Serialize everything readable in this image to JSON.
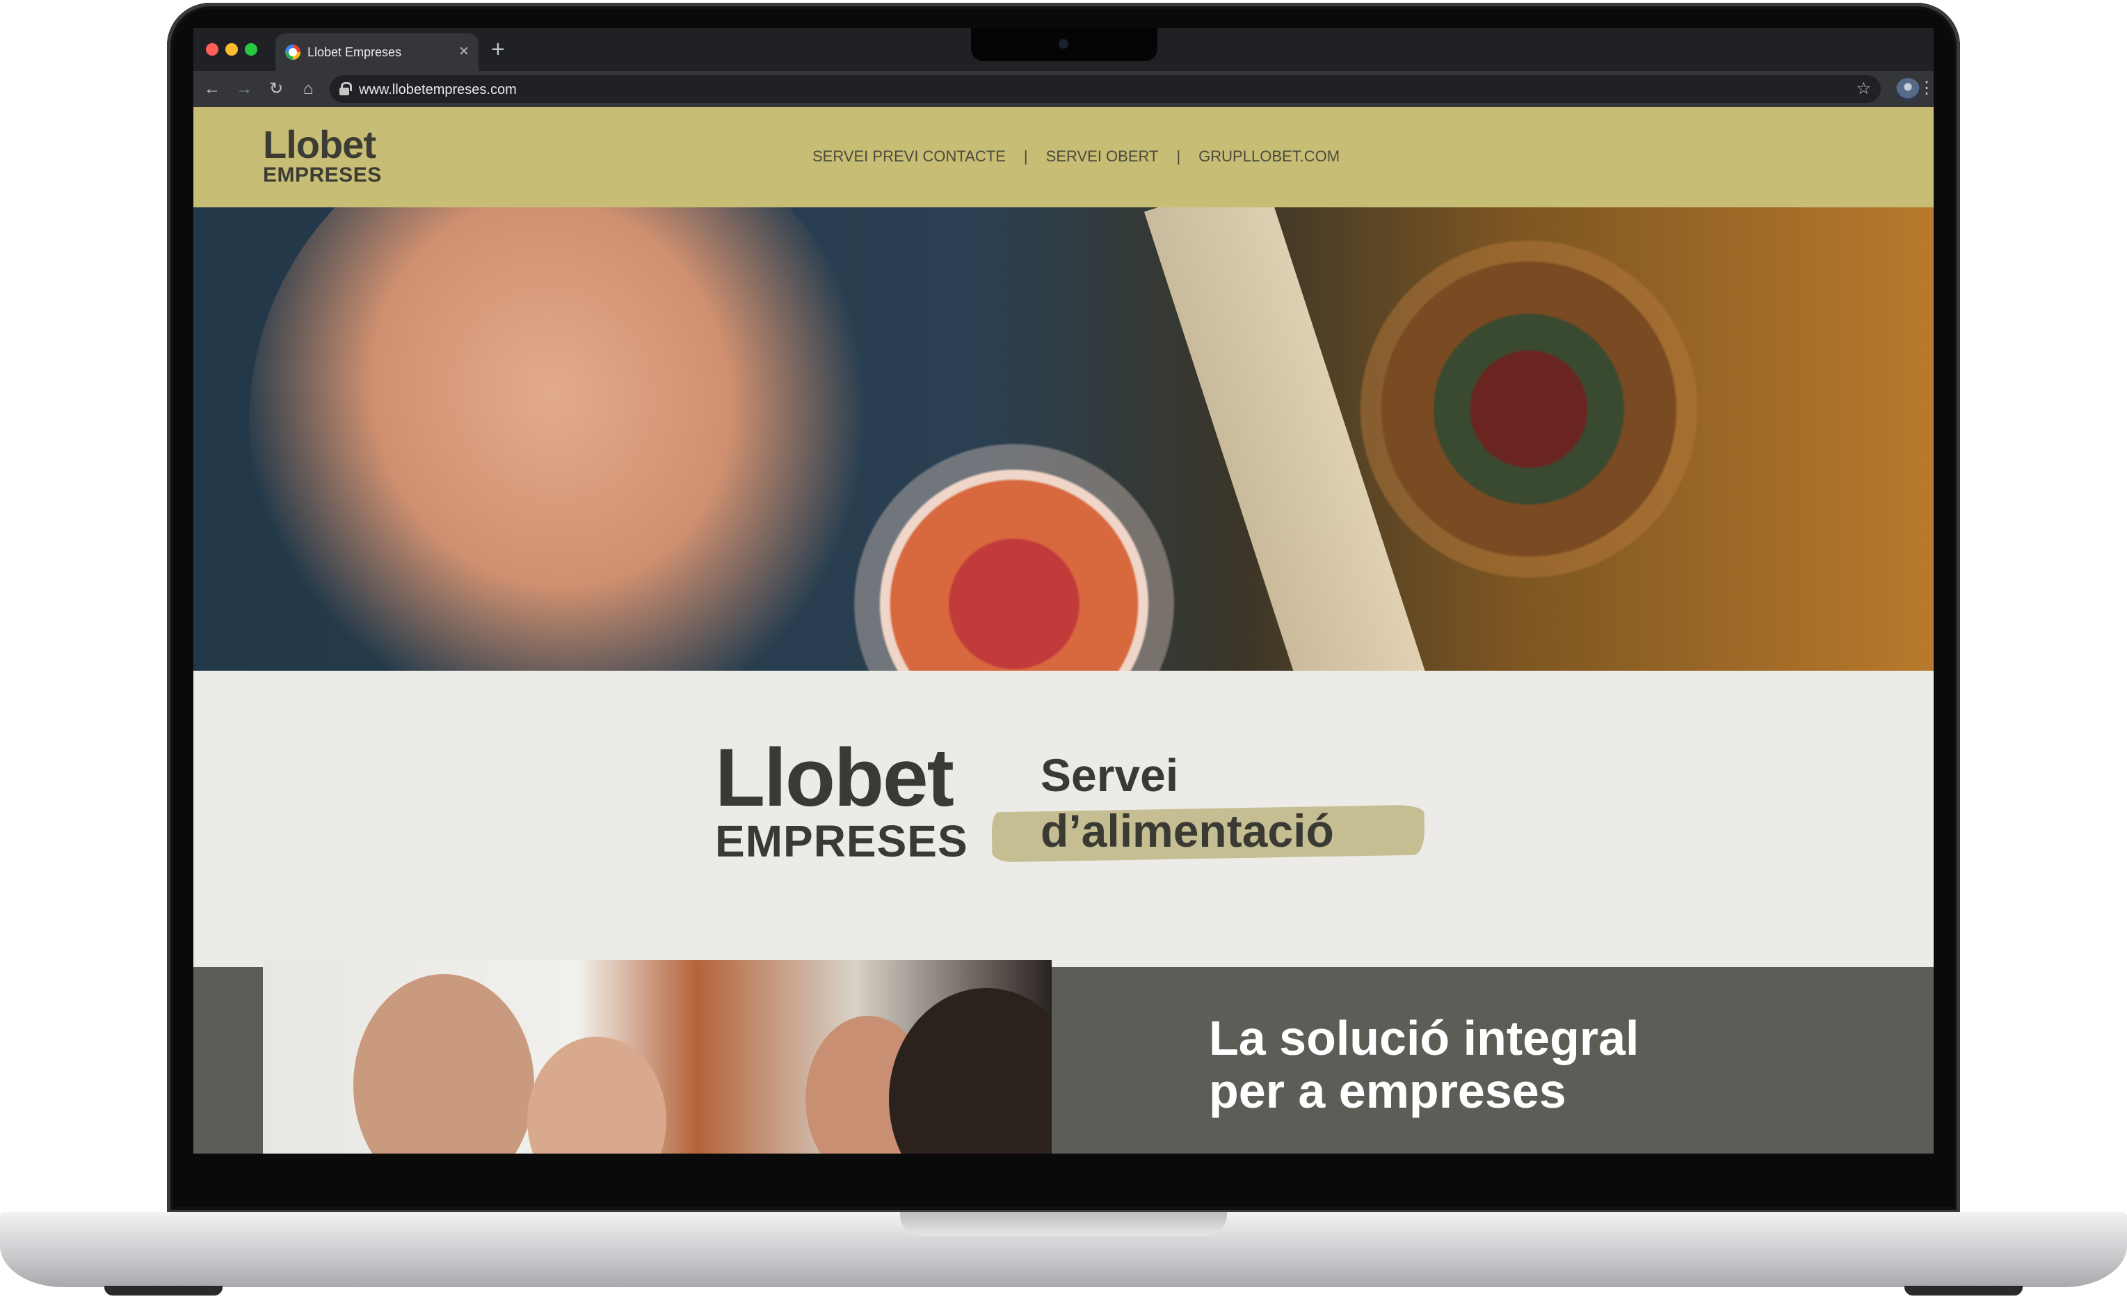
{
  "browser": {
    "tab_title": "Llobet Empreses",
    "tab_close": "×",
    "new_tab": "+",
    "url": "www.llobetempreses.com",
    "nav_icons": {
      "back": "←",
      "forward": "→",
      "reload": "↻",
      "home": "⌂",
      "star": "☆",
      "menu": "⋮"
    }
  },
  "site": {
    "header": {
      "logo_line1": "Llobet",
      "logo_line2": "EMPRESES",
      "nav": [
        "SERVEI PREVI CONTACTE",
        "SERVEI OBERT",
        "GRUPLLOBET.COM"
      ],
      "nav_separator": "|"
    },
    "brand": {
      "logo_line1": "Llobet",
      "logo_line2": "EMPRESES",
      "tagline_line1": "Servei",
      "tagline_line2": "d’alimentació"
    },
    "section2": {
      "title_line1": "La solució integral",
      "title_line2": "per a empreses"
    },
    "colors": {
      "header_bg": "#c8bd75",
      "brand_bg": "#ecebe7",
      "dark_bg": "#5d5d58",
      "brush_accent": "#c6be93",
      "text_dark": "#3a3a34"
    }
  }
}
